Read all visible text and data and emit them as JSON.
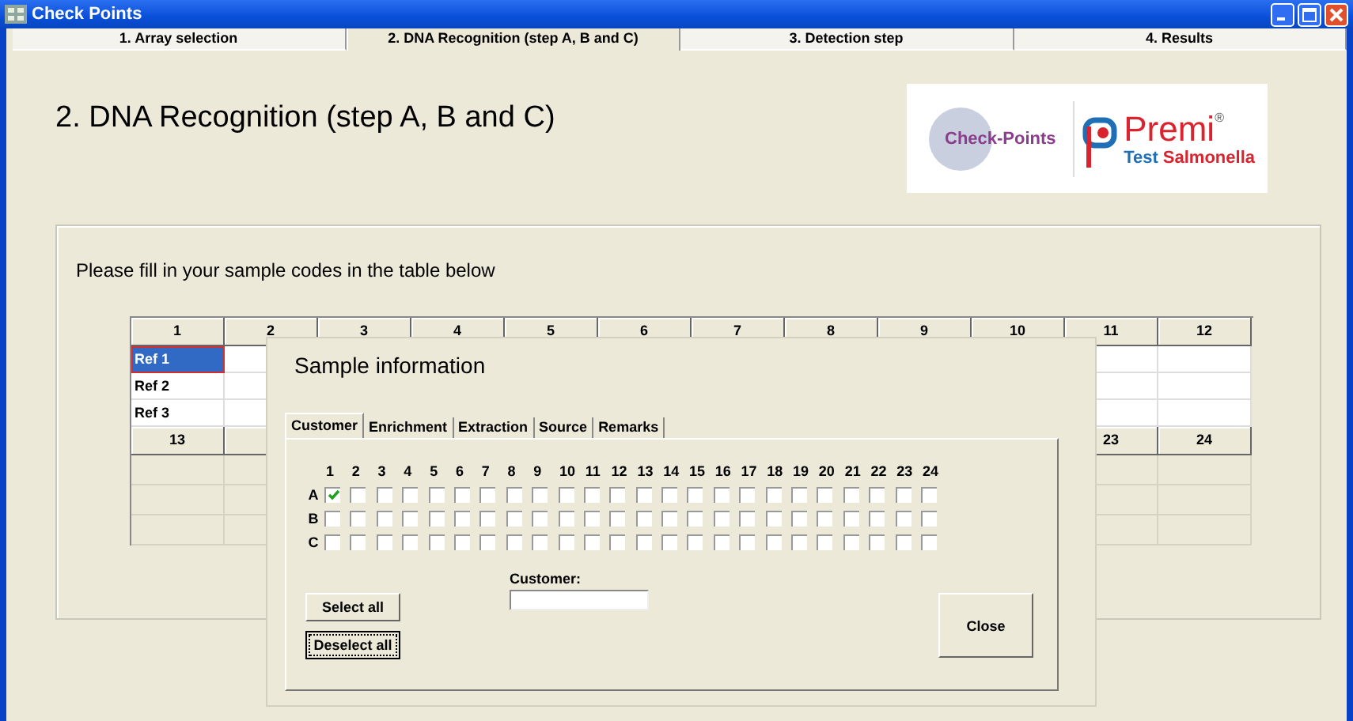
{
  "window": {
    "title": "Check Points"
  },
  "tabs": [
    {
      "label": "1. Array selection",
      "selected": false
    },
    {
      "label": "2. DNA Recognition (step A, B and C)",
      "selected": true
    },
    {
      "label": "3. Detection step",
      "selected": false
    },
    {
      "label": "4. Results",
      "selected": false
    }
  ],
  "heading": "2. DNA Recognition (step A, B and C)",
  "logo": {
    "left": "Check-Points",
    "right": "Premi",
    "mark": "®",
    "subtitle_1": "Test",
    "subtitle_2": "Salmonella"
  },
  "instruction": "Please fill in your sample codes in the table below",
  "table": {
    "header_1": [
      "1",
      "2",
      "3",
      "4",
      "5",
      "6",
      "7",
      "8",
      "9",
      "10",
      "11",
      "12"
    ],
    "rows": [
      {
        "label": "Ref 1",
        "selected": true
      },
      {
        "label": "Ref 2",
        "selected": false
      },
      {
        "label": "Ref 3",
        "selected": false
      }
    ],
    "header_2_first": "13",
    "header_2_last": [
      "23",
      "24"
    ]
  },
  "dialog": {
    "title": "Sample information",
    "tabs": [
      {
        "label": "Customer",
        "selected": true
      },
      {
        "label": "Enrichment",
        "selected": false
      },
      {
        "label": "Extraction",
        "selected": false
      },
      {
        "label": "Source",
        "selected": false
      },
      {
        "label": "Remarks",
        "selected": false
      }
    ],
    "columns": [
      "1",
      "2",
      "3",
      "4",
      "5",
      "6",
      "7",
      "8",
      "9",
      "10",
      "11",
      "12",
      "13",
      "14",
      "15",
      "16",
      "17",
      "18",
      "19",
      "20",
      "21",
      "22",
      "23",
      "24"
    ],
    "rows": [
      {
        "label": "A",
        "boxes": [
          {
            "checked": true
          },
          {
            "checked": false
          },
          {
            "checked": false
          },
          {
            "checked": false
          },
          {
            "checked": false
          },
          {
            "checked": false
          },
          {
            "checked": false
          },
          {
            "checked": false
          },
          {
            "checked": false
          },
          {
            "checked": false
          },
          {
            "checked": false
          },
          {
            "checked": false
          },
          {
            "checked": false
          },
          {
            "checked": false
          },
          {
            "checked": false
          },
          {
            "checked": false
          },
          {
            "checked": false
          },
          {
            "checked": false
          },
          {
            "checked": false
          },
          {
            "checked": false
          },
          {
            "checked": false
          },
          {
            "checked": false
          },
          {
            "checked": false
          },
          {
            "checked": false
          }
        ]
      },
      {
        "label": "B",
        "boxes": [
          {
            "checked": false
          },
          {
            "checked": false
          },
          {
            "checked": false
          },
          {
            "checked": false
          },
          {
            "checked": false
          },
          {
            "checked": false
          },
          {
            "checked": false
          },
          {
            "checked": false
          },
          {
            "checked": false
          },
          {
            "checked": false
          },
          {
            "checked": false
          },
          {
            "checked": false
          },
          {
            "checked": false
          },
          {
            "checked": false
          },
          {
            "checked": false
          },
          {
            "checked": false
          },
          {
            "checked": false
          },
          {
            "checked": false
          },
          {
            "checked": false
          },
          {
            "checked": false
          },
          {
            "checked": false
          },
          {
            "checked": false
          },
          {
            "checked": false
          },
          {
            "checked": false
          }
        ]
      },
      {
        "label": "C",
        "boxes": [
          {
            "checked": false
          },
          {
            "checked": false
          },
          {
            "checked": false
          },
          {
            "checked": false
          },
          {
            "checked": false
          },
          {
            "checked": false
          },
          {
            "checked": false
          },
          {
            "checked": false
          },
          {
            "checked": false
          },
          {
            "checked": false
          },
          {
            "checked": false
          },
          {
            "checked": false
          },
          {
            "checked": false
          },
          {
            "checked": false
          },
          {
            "checked": false
          },
          {
            "checked": false
          },
          {
            "checked": false
          },
          {
            "checked": false
          },
          {
            "checked": false
          },
          {
            "checked": false
          },
          {
            "checked": false
          },
          {
            "checked": false
          },
          {
            "checked": false
          },
          {
            "checked": false
          }
        ]
      }
    ],
    "customer_label": "Customer:",
    "select_all": "Select all",
    "deselect_all": "Deselect all",
    "close": "Close"
  }
}
